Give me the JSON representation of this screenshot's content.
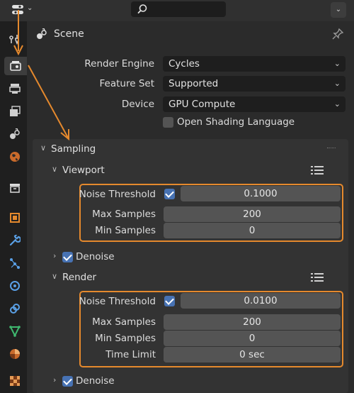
{
  "header": {
    "editor_type_icon": "properties-editor-icon",
    "search_icon": "search-icon",
    "options_icon": "chevron-down-icon"
  },
  "tabs": [
    {
      "name": "tool-tab-icon",
      "active": false
    },
    {
      "name": "render-tab-icon",
      "active": true
    },
    {
      "name": "output-tab-icon",
      "active": false
    },
    {
      "name": "view-layer-tab-icon",
      "active": false
    },
    {
      "name": "scene-tab-icon",
      "active": false
    },
    {
      "name": "world-tab-icon",
      "active": false
    },
    {
      "name": "collection-tab-icon",
      "active": false
    },
    {
      "name": "object-tab-icon",
      "active": false
    },
    {
      "name": "modifier-tab-icon",
      "active": false
    },
    {
      "name": "particles-tab-icon",
      "active": false
    },
    {
      "name": "physics-tab-icon",
      "active": false
    },
    {
      "name": "constraints-tab-icon",
      "active": false
    },
    {
      "name": "data-tab-icon",
      "active": false
    },
    {
      "name": "material-tab-icon",
      "active": false
    },
    {
      "name": "texture-tab-icon",
      "active": false
    }
  ],
  "context": {
    "label": "Scene"
  },
  "render_props": {
    "engine_label": "Render Engine",
    "engine_value": "Cycles",
    "feature_set_label": "Feature Set",
    "feature_set_value": "Supported",
    "device_label": "Device",
    "device_value": "GPU Compute",
    "osl_label": "Open Shading Language",
    "osl_checked": false
  },
  "sampling": {
    "label": "Sampling",
    "viewport": {
      "label": "Viewport",
      "noise_threshold_label": "Noise Threshold",
      "noise_threshold_checked": true,
      "noise_threshold_value": "0.1000",
      "max_samples_label": "Max Samples",
      "max_samples_value": "200",
      "min_samples_label": "Min Samples",
      "min_samples_value": "0",
      "denoise_label": "Denoise",
      "denoise_checked": true
    },
    "render": {
      "label": "Render",
      "noise_threshold_label": "Noise Threshold",
      "noise_threshold_checked": true,
      "noise_threshold_value": "0.0100",
      "max_samples_label": "Max Samples",
      "max_samples_value": "200",
      "min_samples_label": "Min Samples",
      "min_samples_value": "0",
      "time_limit_label": "Time Limit",
      "time_limit_value": "0 sec",
      "denoise_label": "Denoise",
      "denoise_checked": true
    }
  },
  "colors": {
    "highlight": "#e5892d",
    "accent": "#4772b3"
  }
}
